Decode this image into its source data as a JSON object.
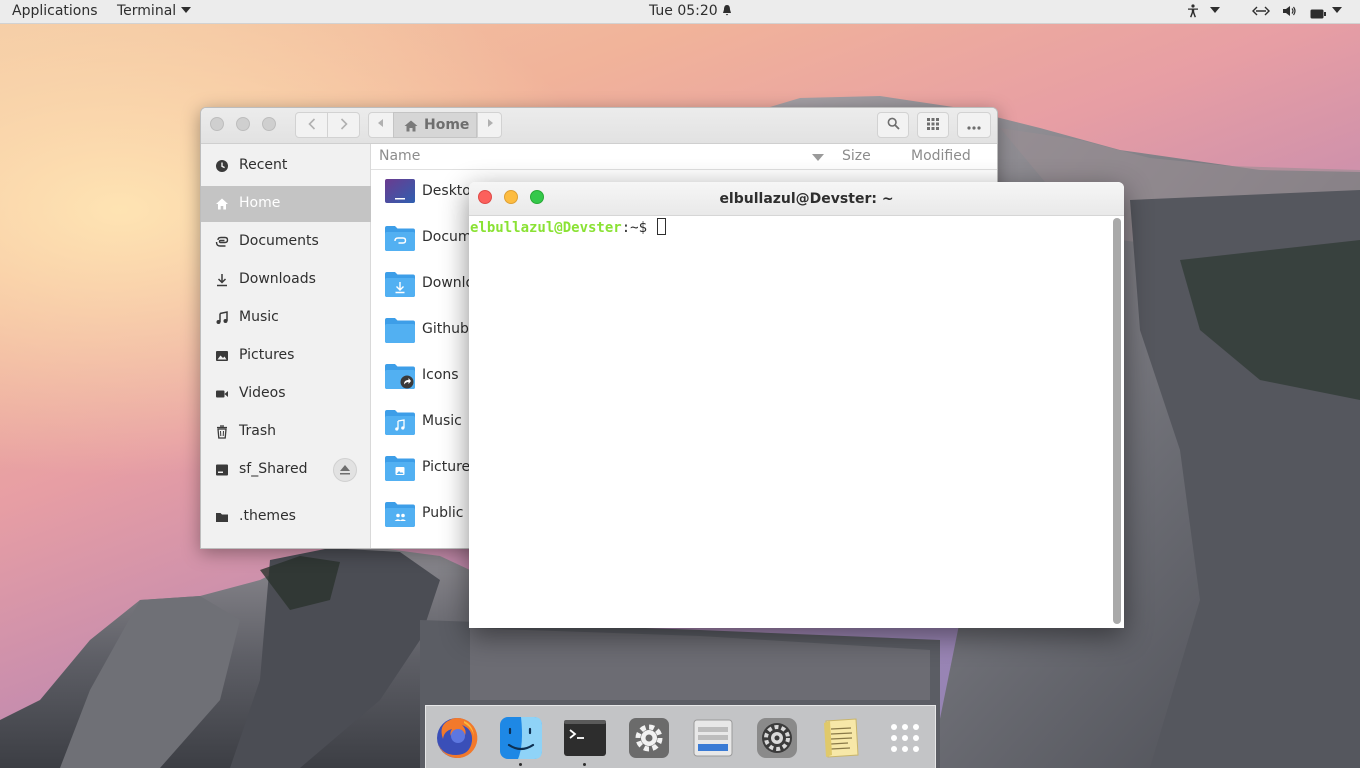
{
  "topbar": {
    "applications": "Applications",
    "app_menu": "Terminal",
    "clock": "Tue 05:20",
    "indicators": [
      "accessibility-icon",
      "network-icon",
      "volume-icon",
      "battery-icon"
    ]
  },
  "files": {
    "breadcrumb": "Home",
    "sidebar": [
      {
        "label": "Recent",
        "icon": "clock-icon"
      },
      {
        "label": "Home",
        "icon": "home-icon",
        "active": true
      },
      {
        "label": "Documents",
        "icon": "document-icon"
      },
      {
        "label": "Downloads",
        "icon": "download-icon"
      },
      {
        "label": "Music",
        "icon": "music-icon"
      },
      {
        "label": "Pictures",
        "icon": "picture-icon"
      },
      {
        "label": "Videos",
        "icon": "video-icon"
      },
      {
        "label": "Trash",
        "icon": "trash-icon"
      },
      {
        "label": "sf_Shared",
        "icon": "drive-icon"
      },
      {
        "label": ".themes",
        "icon": "folder-icon"
      }
    ],
    "columns": {
      "name": "Name",
      "size": "Size",
      "modified": "Modified"
    },
    "rows": [
      {
        "name": "Deskto",
        "icon": "desktop-folder-icon"
      },
      {
        "name": "Docum",
        "icon": "documents-folder-icon"
      },
      {
        "name": "Downlo",
        "icon": "downloads-folder-icon"
      },
      {
        "name": "Github",
        "icon": "folder-icon"
      },
      {
        "name": "Icons",
        "icon": "symlink-folder-icon"
      },
      {
        "name": "Music",
        "icon": "music-folder-icon"
      },
      {
        "name": "Picture",
        "icon": "pictures-folder-icon"
      },
      {
        "name": "Public",
        "icon": "public-folder-icon"
      }
    ]
  },
  "terminal": {
    "title": "elbullazul@Devster: ~",
    "prompt_user": "elbullazul@Devster",
    "prompt_rest": ":~$ "
  },
  "dock": {
    "items": [
      "firefox-icon",
      "finder-icon",
      "terminal-icon",
      "settings-icon",
      "drives-icon",
      "system-preferences-icon",
      "text-editor-icon",
      "app-grid-icon"
    ],
    "running": [
      "finder-icon",
      "terminal-icon"
    ]
  },
  "colors": {
    "prompt_green": "#8ae234",
    "folder_blue": "#3d9ee8",
    "close_red": "#fc605c",
    "minimize_yellow": "#fdbc40",
    "maximize_green": "#34c84a"
  }
}
